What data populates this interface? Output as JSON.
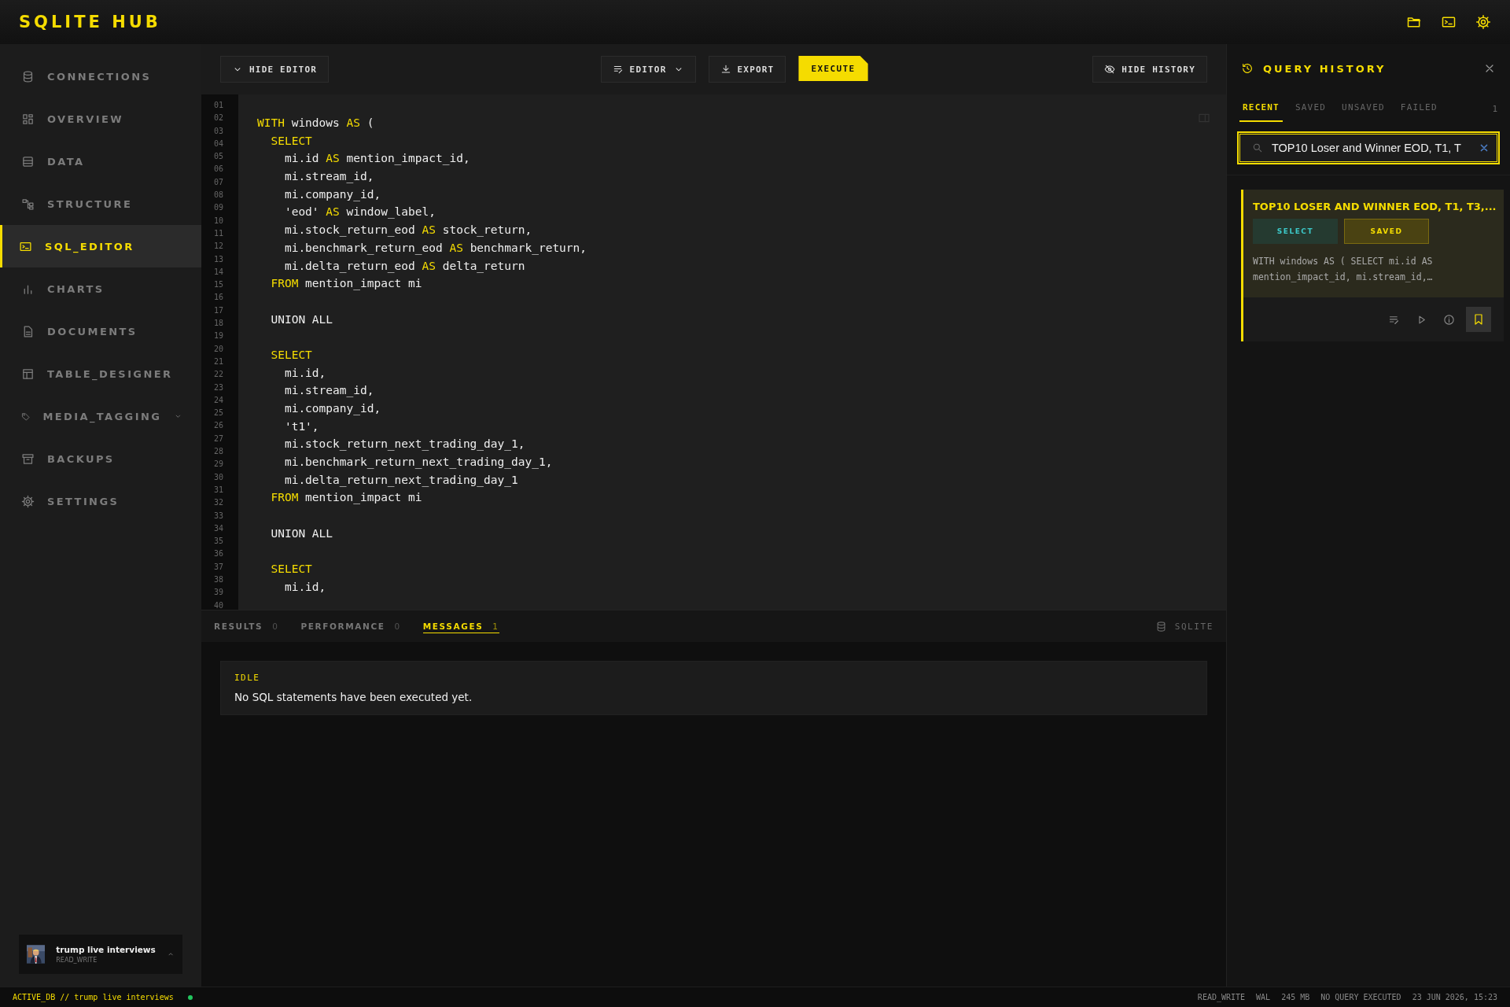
{
  "app": {
    "title": "SQLITE HUB"
  },
  "sidebar": {
    "items": [
      {
        "label": "CONNECTIONS",
        "selected": false,
        "kind": "link"
      },
      {
        "label": "OVERVIEW",
        "selected": false,
        "kind": "link"
      },
      {
        "label": "DATA",
        "selected": false,
        "kind": "link"
      },
      {
        "label": "STRUCTURE",
        "selected": false,
        "kind": "link"
      },
      {
        "label": "SQL_EDITOR",
        "selected": true,
        "kind": "link"
      },
      {
        "label": "CHARTS",
        "selected": false,
        "kind": "link"
      },
      {
        "label": "DOCUMENTS",
        "selected": false,
        "kind": "link"
      },
      {
        "label": "TABLE_DESIGNER",
        "selected": false,
        "kind": "link"
      },
      {
        "label": "MEDIA_TAGGING",
        "selected": false,
        "kind": "group"
      },
      {
        "label": "BACKUPS",
        "selected": false,
        "kind": "link"
      },
      {
        "label": "SETTINGS",
        "selected": false,
        "kind": "link"
      }
    ],
    "profile": {
      "name": "trump live interviews",
      "role": "READ_WRITE"
    }
  },
  "toolbar": {
    "hide_editor": "HIDE EDITOR",
    "mode": "EDITOR",
    "export": "EXPORT",
    "execute": "EXECUTE",
    "hide_history": "HIDE HISTORY"
  },
  "editor": {
    "line_numbers": [
      "01",
      "02",
      "03",
      "04",
      "05",
      "06",
      "07",
      "08",
      "09",
      "10",
      "11",
      "12",
      "13",
      "14",
      "15",
      "16",
      "17",
      "18",
      "19",
      "20",
      "21",
      "22",
      "23",
      "24",
      "25",
      "26",
      "27",
      "28",
      "29",
      "30",
      "31",
      "32",
      "33",
      "34",
      "35",
      "36",
      "37",
      "38",
      "39",
      "40"
    ],
    "lines": [
      {
        "kind": "code",
        "segments": [
          {
            "text": "WITH",
            "kind": "keyword"
          },
          {
            "text": " windows ",
            "kind": "plain"
          },
          {
            "text": "AS",
            "kind": "keyword"
          },
          {
            "text": " (",
            "kind": "plain"
          }
        ]
      },
      {
        "kind": "code",
        "segments": [
          {
            "text": "  SELECT",
            "kind": "keyword"
          }
        ]
      },
      {
        "kind": "code",
        "segments": [
          {
            "text": "    mi.id ",
            "kind": "plain"
          },
          {
            "text": "AS",
            "kind": "keyword"
          },
          {
            "text": " mention_impact_id,",
            "kind": "plain"
          }
        ]
      },
      {
        "kind": "code",
        "segments": [
          {
            "text": "    mi.stream_id,",
            "kind": "plain"
          }
        ]
      },
      {
        "kind": "code",
        "segments": [
          {
            "text": "    mi.company_id,",
            "kind": "plain"
          }
        ]
      },
      {
        "kind": "code",
        "segments": [
          {
            "text": "    'eod' ",
            "kind": "plain"
          },
          {
            "text": "AS",
            "kind": "keyword"
          },
          {
            "text": " window_label,",
            "kind": "plain"
          }
        ]
      },
      {
        "kind": "code",
        "segments": [
          {
            "text": "    mi.stock_return_eod ",
            "kind": "plain"
          },
          {
            "text": "AS",
            "kind": "keyword"
          },
          {
            "text": " stock_return,",
            "kind": "plain"
          }
        ]
      },
      {
        "kind": "code",
        "segments": [
          {
            "text": "    mi.benchmark_return_eod ",
            "kind": "plain"
          },
          {
            "text": "AS",
            "kind": "keyword"
          },
          {
            "text": " benchmark_return,",
            "kind": "plain"
          }
        ]
      },
      {
        "kind": "code",
        "segments": [
          {
            "text": "    mi.delta_return_eod ",
            "kind": "plain"
          },
          {
            "text": "AS",
            "kind": "keyword"
          },
          {
            "text": " delta_return",
            "kind": "plain"
          }
        ]
      },
      {
        "kind": "code",
        "segments": [
          {
            "text": "  FROM",
            "kind": "keyword"
          },
          {
            "text": " mention_impact mi",
            "kind": "plain"
          }
        ]
      },
      {
        "kind": "blank"
      },
      {
        "kind": "code",
        "segments": [
          {
            "text": "  UNION ALL",
            "kind": "plain"
          }
        ]
      },
      {
        "kind": "blank"
      },
      {
        "kind": "code",
        "segments": [
          {
            "text": "  SELECT",
            "kind": "keyword"
          }
        ]
      },
      {
        "kind": "code",
        "segments": [
          {
            "text": "    mi.id,",
            "kind": "plain"
          }
        ]
      },
      {
        "kind": "code",
        "segments": [
          {
            "text": "    mi.stream_id,",
            "kind": "plain"
          }
        ]
      },
      {
        "kind": "code",
        "segments": [
          {
            "text": "    mi.company_id,",
            "kind": "plain"
          }
        ]
      },
      {
        "kind": "code",
        "segments": [
          {
            "text": "    't1',",
            "kind": "plain"
          }
        ]
      },
      {
        "kind": "code",
        "segments": [
          {
            "text": "    mi.stock_return_next_trading_day_1,",
            "kind": "plain"
          }
        ]
      },
      {
        "kind": "code",
        "segments": [
          {
            "text": "    mi.benchmark_return_next_trading_day_1,",
            "kind": "plain"
          }
        ]
      },
      {
        "kind": "code",
        "segments": [
          {
            "text": "    mi.delta_return_next_trading_day_1",
            "kind": "plain"
          }
        ]
      },
      {
        "kind": "code",
        "segments": [
          {
            "text": "  FROM",
            "kind": "keyword"
          },
          {
            "text": " mention_impact mi",
            "kind": "plain"
          }
        ]
      },
      {
        "kind": "blank"
      },
      {
        "kind": "code",
        "segments": [
          {
            "text": "  UNION ALL",
            "kind": "plain"
          }
        ]
      },
      {
        "kind": "blank"
      },
      {
        "kind": "code",
        "segments": [
          {
            "text": "  SELECT",
            "kind": "keyword"
          }
        ]
      },
      {
        "kind": "code",
        "segments": [
          {
            "text": "    mi.id,",
            "kind": "plain"
          }
        ]
      }
    ]
  },
  "results": {
    "tabs": [
      {
        "label": "RESULTS",
        "count": "0",
        "selected": false
      },
      {
        "label": "PERFORMANCE",
        "count": "0",
        "selected": false
      },
      {
        "label": "MESSAGES",
        "count": "1",
        "selected": true
      }
    ],
    "engine": "SQLITE",
    "message": {
      "status": "IDLE",
      "text": "No SQL statements have been executed yet."
    }
  },
  "history": {
    "title": "QUERY HISTORY",
    "tabs": [
      {
        "label": "RECENT",
        "selected": true
      },
      {
        "label": "SAVED",
        "selected": false
      },
      {
        "label": "UNSAVED",
        "selected": false
      },
      {
        "label": "FAILED",
        "selected": false
      }
    ],
    "count": "1",
    "search": {
      "value": "TOP10 Loser and Winner EOD, T1, T"
    },
    "entries": [
      {
        "title": "TOP10 LOSER AND WINNER EOD, T1, T3,...",
        "type": "SELECT",
        "status": "SAVED",
        "preview": "WITH windows AS ( SELECT mi.id AS mention_impact_id, mi.stream_id,…",
        "bookmarked": true
      }
    ]
  },
  "status_bar": {
    "active_db": "ACTIVE_DB // trump live interviews",
    "connected": true,
    "items": [
      "READ_WRITE",
      "WAL",
      "245 MB",
      "NO QUERY EXECUTED",
      "23 JUN 2026, 15:23"
    ]
  }
}
